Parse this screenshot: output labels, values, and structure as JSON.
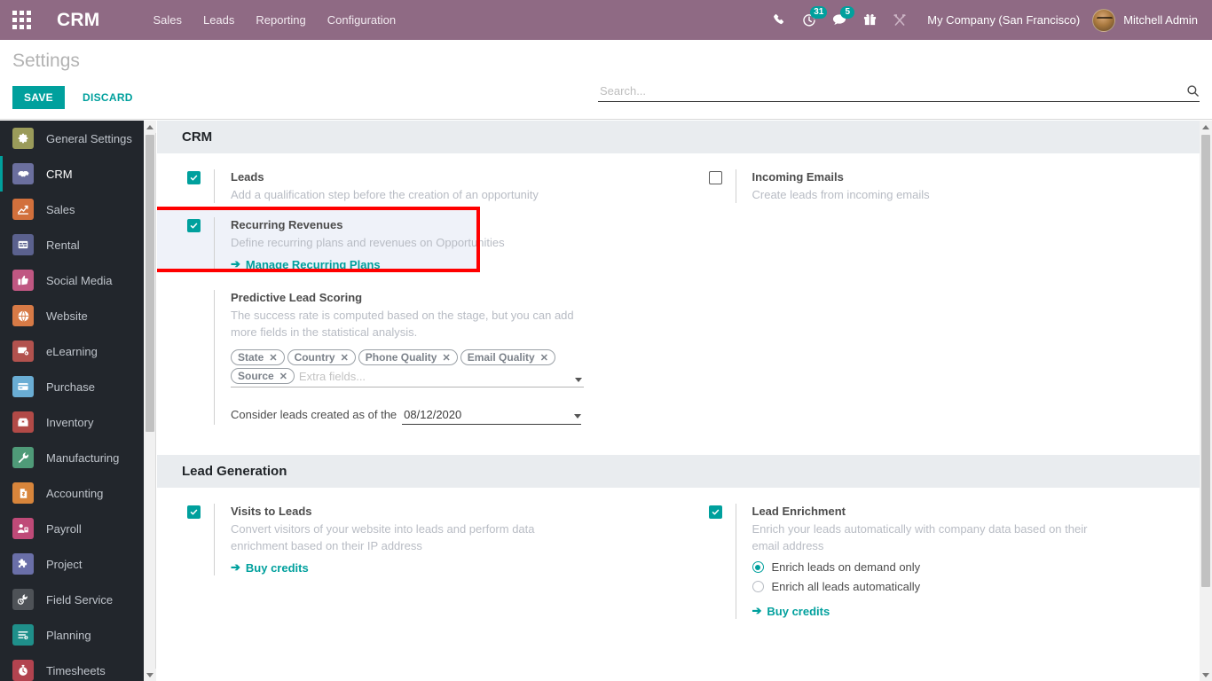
{
  "topbar": {
    "apps_icon": "apps-grid-icon",
    "brand": "CRM",
    "menus": [
      {
        "label": "Sales"
      },
      {
        "label": "Leads"
      },
      {
        "label": "Reporting"
      },
      {
        "label": "Configuration"
      }
    ],
    "sys_icons": [
      {
        "name": "phone-icon",
        "badge": ""
      },
      {
        "name": "activity-clock-icon",
        "badge": "31"
      },
      {
        "name": "messages-icon",
        "badge": "5"
      },
      {
        "name": "gift-icon",
        "badge": ""
      },
      {
        "name": "developer-tools-icon",
        "badge": ""
      }
    ],
    "company": "My Company (San Francisco)",
    "user": "Mitchell Admin",
    "accent": "#8f6a84",
    "badge_color": "#00a09d"
  },
  "controlpanel": {
    "title": "Settings",
    "save_label": "SAVE",
    "discard_label": "DISCARD",
    "search_placeholder": "Search...",
    "search_value": "",
    "search_icon": "search-icon",
    "save_color": "#00a09d"
  },
  "sidebar": {
    "items": [
      {
        "label": "General Settings",
        "icon": "gear-icon",
        "color": "#9a9b5a",
        "active": false
      },
      {
        "label": "CRM",
        "icon": "handshake-icon",
        "color": "#6b6f9e",
        "active": true
      },
      {
        "label": "Sales",
        "icon": "chart-line-icon",
        "color": "#d2703c",
        "active": false
      },
      {
        "label": "Rental",
        "icon": "calendar-icon",
        "color": "#5b618e",
        "active": false
      },
      {
        "label": "Social Media",
        "icon": "thumbs-up-icon",
        "color": "#c05782",
        "active": false
      },
      {
        "label": "Website",
        "icon": "globe-icon",
        "color": "#d77a46",
        "active": false
      },
      {
        "label": "eLearning",
        "icon": "screen-share-icon",
        "color": "#b2524e",
        "active": false
      },
      {
        "label": "Purchase",
        "icon": "card-icon",
        "color": "#6aadd4",
        "active": false
      },
      {
        "label": "Inventory",
        "icon": "box-icon",
        "color": "#b24a47",
        "active": false
      },
      {
        "label": "Manufacturing",
        "icon": "wrench-icon",
        "color": "#4f9a78",
        "active": false
      },
      {
        "label": "Accounting",
        "icon": "invoice-icon",
        "color": "#d8853b",
        "active": false
      },
      {
        "label": "Payroll",
        "icon": "employee-icon",
        "color": "#bf4a78",
        "active": false
      },
      {
        "label": "Project",
        "icon": "puzzle-icon",
        "color": "#6a6fa8",
        "active": false
      },
      {
        "label": "Field Service",
        "icon": "service-tools-icon",
        "color": "#4e5257",
        "active": false
      },
      {
        "label": "Planning",
        "icon": "planning-list-icon",
        "color": "#1f8f8a",
        "active": false
      },
      {
        "label": "Timesheets",
        "icon": "stopwatch-icon",
        "color": "#b2434f",
        "active": false
      }
    ]
  },
  "sections": [
    {
      "id": "crm",
      "header": "CRM",
      "settings": {
        "leads": {
          "title": "Leads",
          "desc": "Add a qualification step before the creation of an opportunity",
          "checked": true
        },
        "incoming_emails": {
          "title": "Incoming Emails",
          "desc": "Create leads from incoming emails",
          "checked": false
        },
        "recurring_revenues": {
          "title": "Recurring Revenues",
          "desc": "Define recurring plans and revenues on Opportunities",
          "link": "Manage Recurring Plans",
          "checked": true,
          "highlighted": true,
          "highlight_color": "#ff0000"
        },
        "predictive_lead_scoring": {
          "title": "Predictive Lead Scoring",
          "desc": "The success rate is computed based on the stage, but you can add more fields in the statistical analysis.",
          "tags": [
            "State",
            "Country",
            "Phone Quality",
            "Email Quality",
            "Source"
          ],
          "tags_placeholder": "Extra fields...",
          "date_label": "Consider leads created as of the",
          "date_value": "08/12/2020"
        }
      }
    },
    {
      "id": "lead_generation",
      "header": "Lead Generation",
      "settings": {
        "visits_to_leads": {
          "title": "Visits to Leads",
          "desc": "Convert visitors of your website into leads and perform data enrichment based on their IP address",
          "link": "Buy credits",
          "checked": true
        },
        "lead_enrichment": {
          "title": "Lead Enrichment",
          "desc": "Enrich your leads automatically with company data based on their email address",
          "link": "Buy credits",
          "checked": true,
          "radios": [
            {
              "label": "Enrich leads on demand only",
              "selected": true
            },
            {
              "label": "Enrich all leads automatically",
              "selected": false
            }
          ]
        }
      }
    }
  ]
}
